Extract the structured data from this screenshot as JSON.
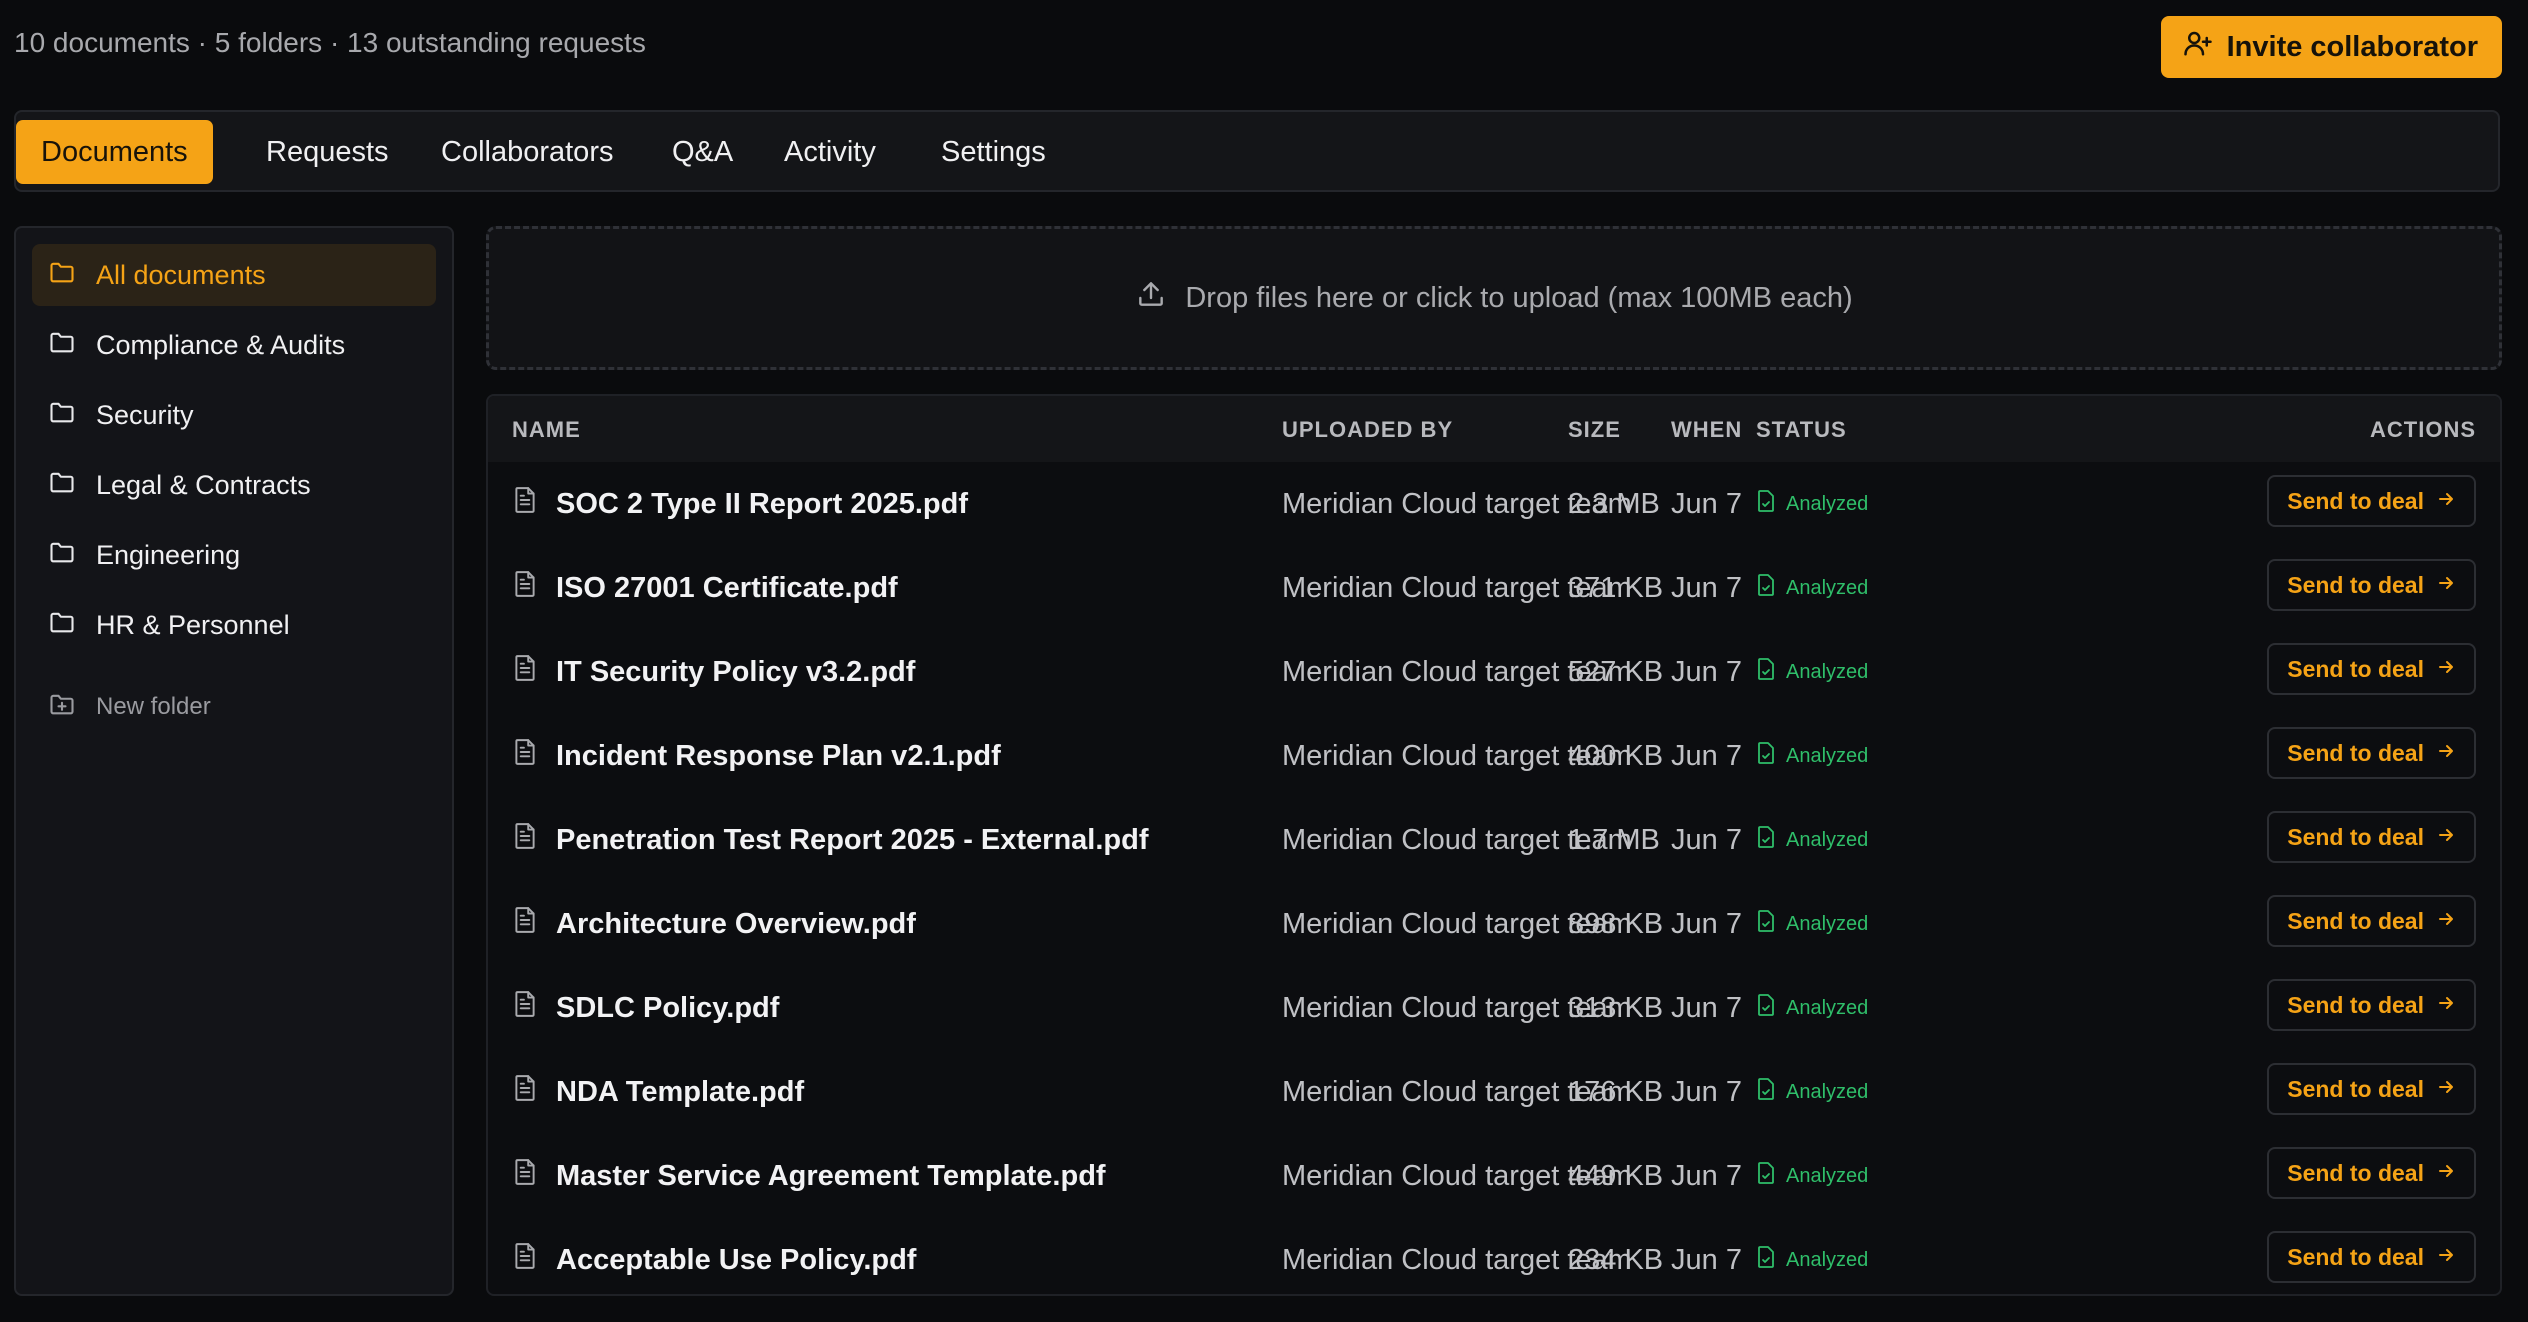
{
  "header": {
    "summary": "10 documents · 5 folders · 13 outstanding requests",
    "invite_label": "Invite collaborator"
  },
  "tabs": [
    {
      "label": "Documents",
      "active": true
    },
    {
      "label": "Requests"
    },
    {
      "label": "Collaborators"
    },
    {
      "label": "Q&A"
    },
    {
      "label": "Activity"
    },
    {
      "label": "Settings"
    }
  ],
  "sidebar": {
    "folders": [
      {
        "label": "All documents",
        "active": true
      },
      {
        "label": "Compliance & Audits"
      },
      {
        "label": "Security"
      },
      {
        "label": "Legal & Contracts"
      },
      {
        "label": "Engineering"
      },
      {
        "label": "HR & Personnel"
      }
    ],
    "new_folder_label": "New folder"
  },
  "dropzone": {
    "label": "Drop files here or click to upload (max 100MB each)"
  },
  "table": {
    "headers": {
      "name": "NAME",
      "uploaded_by": "UPLOADED BY",
      "size": "SIZE",
      "when": "WHEN",
      "status": "STATUS",
      "actions": "ACTIONS"
    },
    "action_label": "Send to deal",
    "rows": [
      {
        "name": "SOC 2 Type II Report 2025.pdf",
        "uploaded_by": "Meridian Cloud target team",
        "size": "2.3 MB",
        "when": "Jun 7",
        "status": "Analyzed"
      },
      {
        "name": "ISO 27001 Certificate.pdf",
        "uploaded_by": "Meridian Cloud target team",
        "size": "371 KB",
        "when": "Jun 7",
        "status": "Analyzed"
      },
      {
        "name": "IT Security Policy v3.2.pdf",
        "uploaded_by": "Meridian Cloud target team",
        "size": "527 KB",
        "when": "Jun 7",
        "status": "Analyzed"
      },
      {
        "name": "Incident Response Plan v2.1.pdf",
        "uploaded_by": "Meridian Cloud target team",
        "size": "400 KB",
        "when": "Jun 7",
        "status": "Analyzed"
      },
      {
        "name": "Penetration Test Report 2025 - External.pdf",
        "uploaded_by": "Meridian Cloud target team",
        "size": "1.7 MB",
        "when": "Jun 7",
        "status": "Analyzed"
      },
      {
        "name": "Architecture Overview.pdf",
        "uploaded_by": "Meridian Cloud target team",
        "size": "898 KB",
        "when": "Jun 7",
        "status": "Analyzed"
      },
      {
        "name": "SDLC Policy.pdf",
        "uploaded_by": "Meridian Cloud target team",
        "size": "313 KB",
        "when": "Jun 7",
        "status": "Analyzed"
      },
      {
        "name": "NDA Template.pdf",
        "uploaded_by": "Meridian Cloud target team",
        "size": "176 KB",
        "when": "Jun 7",
        "status": "Analyzed"
      },
      {
        "name": "Master Service Agreement Template.pdf",
        "uploaded_by": "Meridian Cloud target team",
        "size": "449 KB",
        "when": "Jun 7",
        "status": "Analyzed"
      },
      {
        "name": "Acceptable Use Policy.pdf",
        "uploaded_by": "Meridian Cloud target team",
        "size": "234 KB",
        "when": "Jun 7",
        "status": "Analyzed"
      }
    ]
  },
  "colors": {
    "accent": "#f5a316",
    "status_analyzed": "#2fbf6a",
    "background": "#0a0b0d"
  }
}
